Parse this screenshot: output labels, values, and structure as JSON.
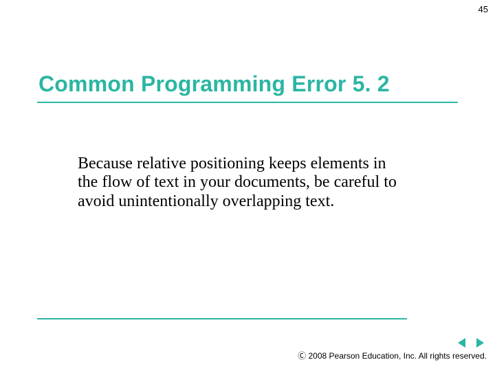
{
  "page_number": "45",
  "title": "Common Programming Error 5. 2",
  "body": "Because relative positioning keeps elements in the flow of text in your documents, be careful to avoid unintentionally overlapping text.",
  "copyright": "Ⓒ 2008 Pearson Education, Inc. All rights reserved.",
  "accent_color": "#2bb6a3"
}
